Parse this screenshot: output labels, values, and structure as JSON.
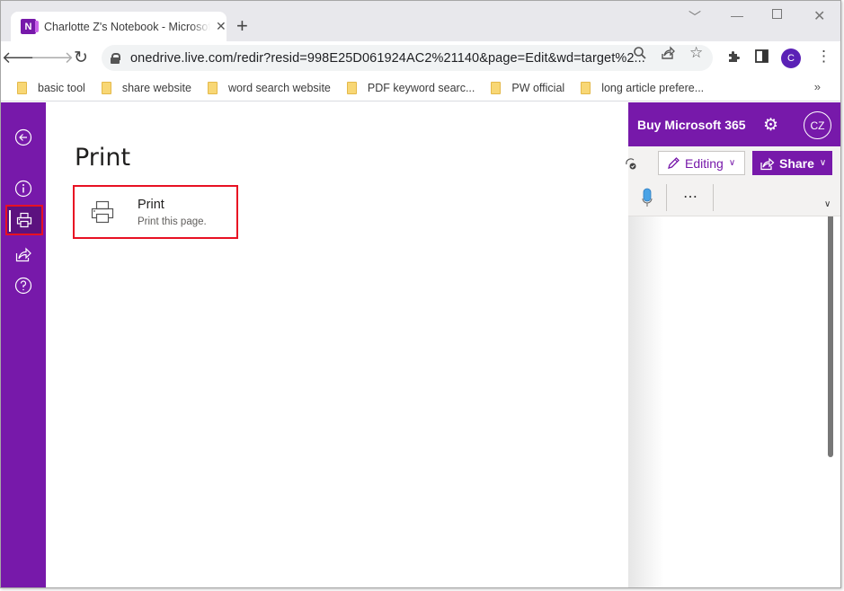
{
  "browser": {
    "tab": {
      "title": "Charlotte Z's Notebook - Microsoft OneNote",
      "favicon": "onenote-icon",
      "favicon_letter": "N"
    },
    "window_controls": {
      "tab_search": "chevron-down-icon",
      "minimize": "minimize-icon",
      "maximize": "maximize-icon",
      "close": "close-icon"
    },
    "address": {
      "url": "onedrive.live.com/redir?resid=998E25D061924AC2%21140&page=Edit&wd=target%2..."
    },
    "profile_initial": "C",
    "bookmarks": [
      {
        "label": "basic tool"
      },
      {
        "label": "share website"
      },
      {
        "label": "word search website"
      },
      {
        "label": "PDF keyword searc..."
      },
      {
        "label": "PW official"
      },
      {
        "label": "long article prefere..."
      }
    ],
    "bookmarks_overflow": "»"
  },
  "app": {
    "rail": [
      {
        "name": "back",
        "icon": "back-arrow-icon"
      },
      {
        "name": "info",
        "icon": "info-icon"
      },
      {
        "name": "print",
        "icon": "printer-icon",
        "active": true
      },
      {
        "name": "share",
        "icon": "share-icon"
      },
      {
        "name": "help",
        "icon": "help-icon"
      }
    ],
    "panel": {
      "title": "Print",
      "option": {
        "title": "Print",
        "description": "Print this page."
      }
    },
    "header": {
      "buy_link": "Buy Microsoft 365",
      "avatar_initials": "CZ"
    },
    "ribbon": {
      "editing_label": "Editing",
      "share_label": "Share",
      "more_label": "⋯"
    },
    "colors": {
      "brand": "#7719aa",
      "highlight": "#e81123"
    }
  }
}
